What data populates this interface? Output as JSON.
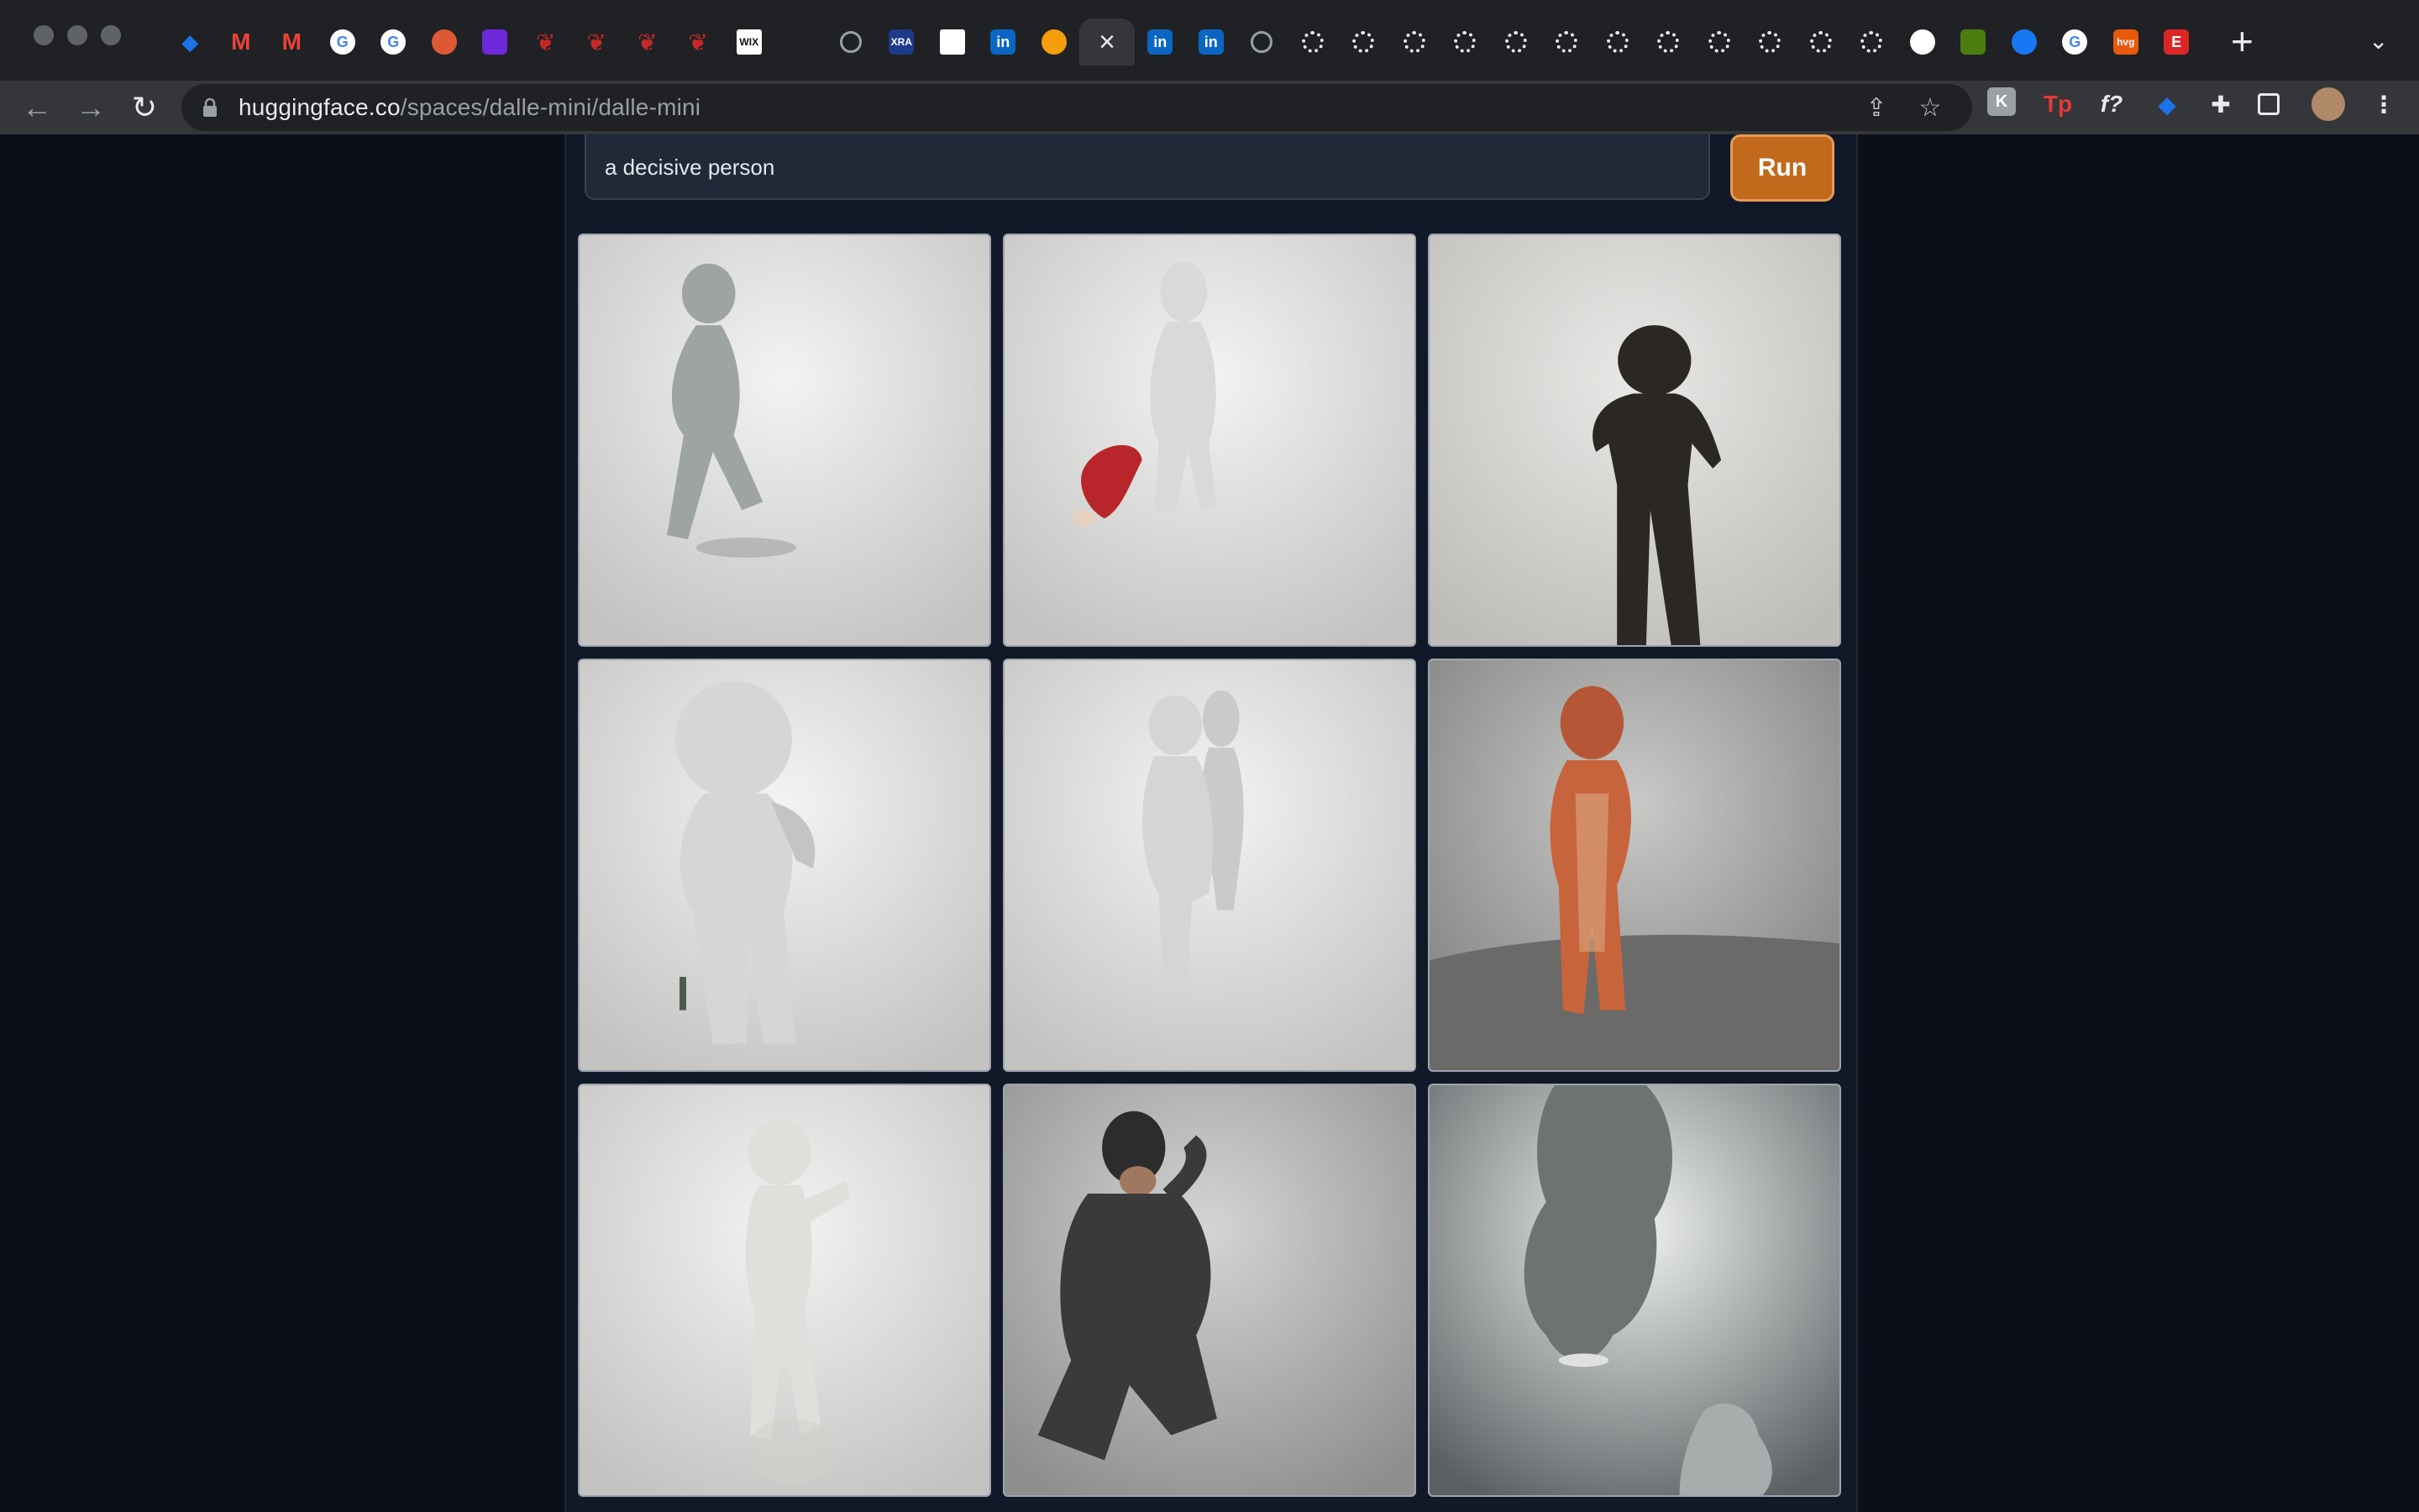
{
  "browser": {
    "url_host": "huggingface.co",
    "url_path": "/spaces/dalle-mini/dalle-mini",
    "tabs": [
      {
        "icon": "gem-icon",
        "color": "#1a73e8"
      },
      {
        "icon": "gmail-icon",
        "color": "#ea4335"
      },
      {
        "icon": "gmail-icon",
        "color": "#ea4335"
      },
      {
        "icon": "google-icon",
        "color": "#4285f4"
      },
      {
        "icon": "google-icon",
        "color": "#4285f4"
      },
      {
        "icon": "duckduckgo-icon",
        "color": "#de5833"
      },
      {
        "icon": "purple-app-icon",
        "color": "#6d28d9"
      },
      {
        "icon": "red-logo-icon",
        "color": "#c62828"
      },
      {
        "icon": "red-logo-icon",
        "color": "#c62828"
      },
      {
        "icon": "red-logo-icon",
        "color": "#c62828"
      },
      {
        "icon": "red-logo-icon",
        "color": "#c62828"
      },
      {
        "icon": "wix-icon",
        "color": "#ffffff",
        "label": "WIX"
      },
      {
        "icon": "blank-icon",
        "color": "#202124"
      },
      {
        "icon": "globe-icon",
        "color": "#9aa0a6"
      },
      {
        "icon": "xra-icon",
        "color": "#1e3a8a",
        "label": "XRA"
      },
      {
        "icon": "white-square-icon",
        "color": "#ffffff"
      },
      {
        "icon": "linkedin-icon",
        "color": "#0a66c2",
        "label": "in"
      },
      {
        "icon": "huggingface-icon",
        "color": "#f59e0b"
      },
      {
        "icon": "close-icon",
        "color": "#e8eaed",
        "active": true
      },
      {
        "icon": "linkedin-icon",
        "color": "#0a66c2",
        "label": "in"
      },
      {
        "icon": "linkedin-icon",
        "color": "#0a66c2",
        "label": "in"
      },
      {
        "icon": "globe-icon",
        "color": "#9aa0a6"
      },
      {
        "icon": "gear-icon",
        "color": "#e8eaed"
      },
      {
        "icon": "gear-icon",
        "color": "#e8eaed"
      },
      {
        "icon": "gear-icon",
        "color": "#e8eaed"
      },
      {
        "icon": "gear-icon",
        "color": "#e8eaed"
      },
      {
        "icon": "gear-icon",
        "color": "#e8eaed"
      },
      {
        "icon": "gear-icon",
        "color": "#e8eaed"
      },
      {
        "icon": "gear-icon",
        "color": "#e8eaed"
      },
      {
        "icon": "gear-icon",
        "color": "#e8eaed"
      },
      {
        "icon": "gear-icon",
        "color": "#e8eaed"
      },
      {
        "icon": "gear-icon",
        "color": "#e8eaed"
      },
      {
        "icon": "gear-icon",
        "color": "#e8eaed"
      },
      {
        "icon": "gear-icon",
        "color": "#e8eaed"
      },
      {
        "icon": "github-icon",
        "color": "#ffffff"
      },
      {
        "icon": "green-badge-icon",
        "color": "#4d7c0f"
      },
      {
        "icon": "facebook-icon",
        "color": "#1877f2"
      },
      {
        "icon": "google-icon",
        "color": "#4285f4"
      },
      {
        "icon": "hvg-icon",
        "color": "#e8590c",
        "label": "hvg"
      },
      {
        "icon": "e-icon",
        "color": "#dc2626",
        "label": "E"
      }
    ],
    "extensions": [
      {
        "icon": "k-extension-icon",
        "color": "#9aa0a6",
        "label": "K"
      },
      {
        "icon": "tp-extension-icon",
        "color": "#e53935",
        "label": "Tp"
      },
      {
        "icon": "function-extension-icon",
        "color": "#e8eaed",
        "label": "f?"
      },
      {
        "icon": "gem-extension-icon",
        "color": "#1a73e8"
      },
      {
        "icon": "puzzle-icon",
        "color": "#e8eaed"
      },
      {
        "icon": "sidepanel-icon",
        "color": "#e8eaed"
      },
      {
        "icon": "profile-avatar",
        "color": "#b08968"
      },
      {
        "icon": "kebab-menu-icon",
        "color": "#e8eaed"
      }
    ]
  },
  "app": {
    "prompt_value": "a decisive person",
    "run_label": "Run",
    "accent": "#c2691c"
  },
  "gallery": [
    {
      "figure": "gray-figure-walking"
    },
    {
      "figure": "white-figure-red-creature"
    },
    {
      "figure": "black-figure"
    },
    {
      "figure": "white-figure-large-head"
    },
    {
      "figure": "two-white-figures"
    },
    {
      "figure": "orange-clay-figure"
    },
    {
      "figure": "white-figure-arm-out"
    },
    {
      "figure": "man-in-suit-kneeling"
    },
    {
      "figure": "gray-silhouette"
    }
  ]
}
